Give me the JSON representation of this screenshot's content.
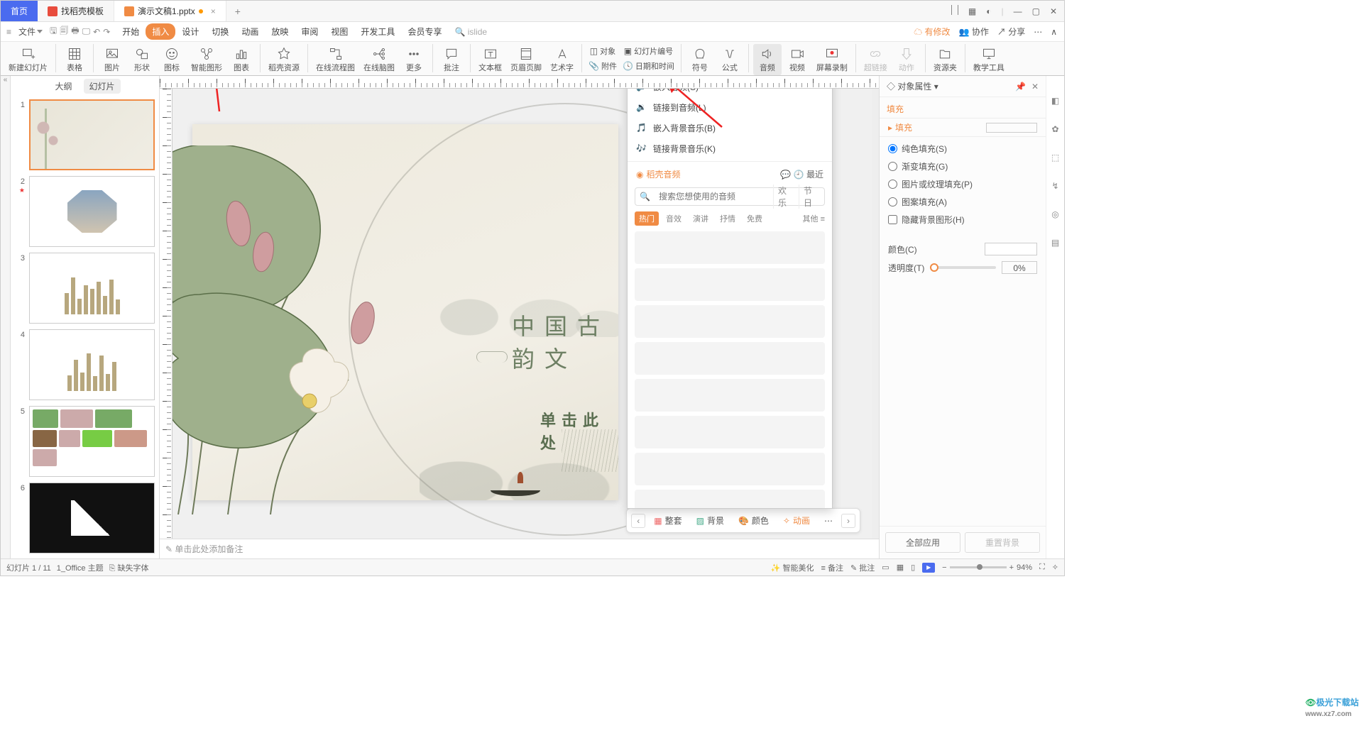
{
  "tabs": {
    "home": "首页",
    "t2": "找稻壳模板",
    "t3": "演示文稿1.pptx"
  },
  "menu": {
    "file": "文件",
    "start": "开始",
    "insert": "插入",
    "design": "设计",
    "trans": "切换",
    "anim": "动画",
    "show": "放映",
    "review": "审阅",
    "view": "视图",
    "dev": "开发工具",
    "vip": "会员专享",
    "islide": "islide",
    "pending": "有修改",
    "coop": "协作",
    "share": "分享"
  },
  "ribbon": {
    "newslide": "新建幻灯片",
    "table": "表格",
    "pic": "图片",
    "shape": "形状",
    "icon": "图标",
    "smart": "智能图形",
    "chart": "图表",
    "dkres": "稻壳资源",
    "flow": "在线流程图",
    "mind": "在线脑图",
    "more": "更多",
    "annotate": "批注",
    "textbox": "文本框",
    "hf": "页眉页脚",
    "wordart": "艺术字",
    "obj": "对象",
    "slnum": "幻灯片编号",
    "attach": "附件",
    "datetime": "日期和时间",
    "symbol": "符号",
    "formula": "公式",
    "audio": "音频",
    "video": "视频",
    "screc": "屏幕录制",
    "link": "超链接",
    "action": "动作",
    "respool": "资源夹",
    "teach": "教学工具"
  },
  "thumbtabs": {
    "outline": "大纲",
    "slides": "幻灯片"
  },
  "slides": {
    "count": 6
  },
  "slide1": {
    "title": "中国古韵文",
    "sub": "单击此处"
  },
  "audio": {
    "opt1": "嵌入音频(S)",
    "opt2": "链接到音频(L)",
    "opt3": "嵌入背景音乐(B)",
    "opt4": "链接背景音乐(K)",
    "source": "稻壳音频",
    "tip": "最近",
    "search_ph": "搜索您想使用的音频",
    "tag1": "欢乐",
    "tag2": "节日",
    "filters": {
      "hot": "热门",
      "f2": "音效",
      "f3": "演讲",
      "f4": "抒情",
      "f5": "免费",
      "more": "其他"
    }
  },
  "design": {
    "suite": "整套",
    "bg": "背景",
    "color": "颜色",
    "anim": "动画"
  },
  "notes": {
    "ph": "单击此处添加备注"
  },
  "panel": {
    "title": "对象属性",
    "tab": "填充",
    "sect": "填充",
    "r1": "纯色填充(S)",
    "r2": "渐变填充(G)",
    "r3": "图片或纹理填充(P)",
    "r4": "图案填充(A)",
    "cb": "隐藏背景图形(H)",
    "color": "颜色(C)",
    "trans": "透明度(T)",
    "trans_val": "0%",
    "apply": "全部应用",
    "reset": "重置背景"
  },
  "status": {
    "pos": "幻灯片 1 / 11",
    "theme": "1_Office 主题",
    "missfont": "缺失字体",
    "beauty": "智能美化",
    "notes": "备注",
    "annot": "批注",
    "zoom": "94%"
  },
  "wm": {
    "a": "极光",
    "b": "下载站",
    "c": "www.xz7.com"
  }
}
